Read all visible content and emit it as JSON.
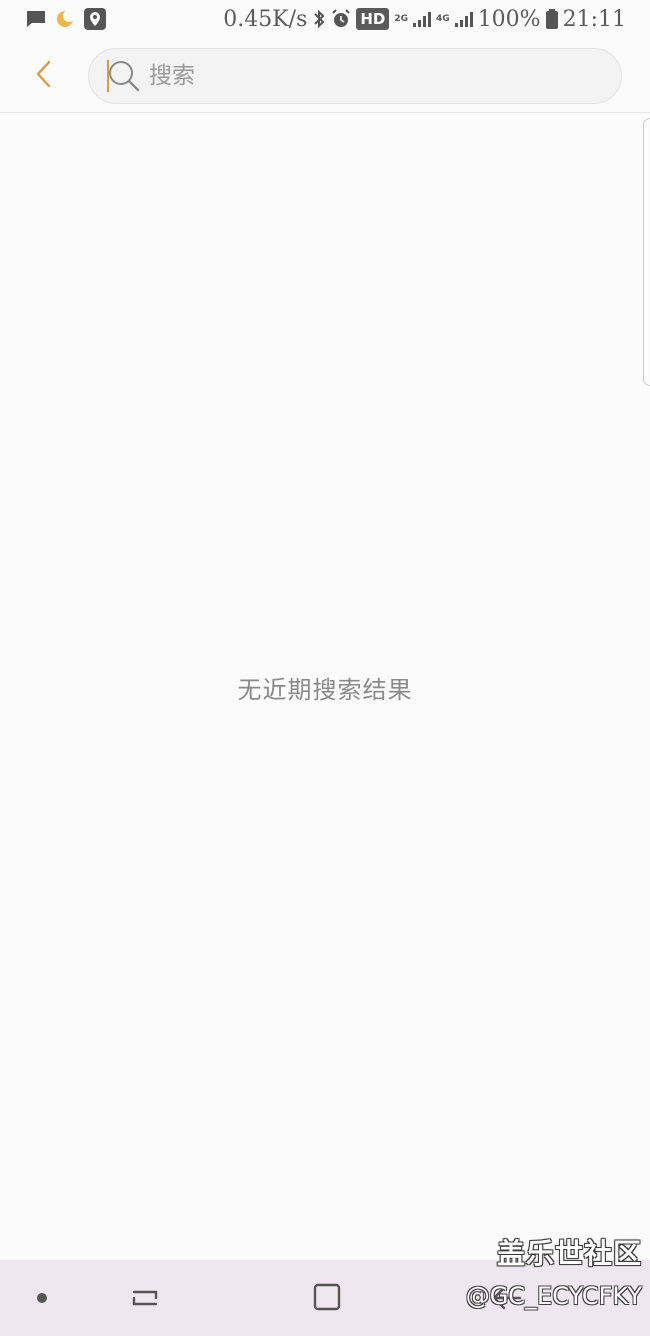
{
  "status_bar": {
    "network_speed": "0.45K/s",
    "hd_badge": "HD",
    "sim1_label": "2G",
    "sim2_label": "4G",
    "battery": "100%",
    "time": "21:11",
    "icons": [
      "message-icon",
      "moon-icon",
      "location-icon",
      "bluetooth-icon",
      "alarm-icon",
      "signal-icon",
      "battery-icon"
    ]
  },
  "search": {
    "placeholder": "搜索",
    "value": ""
  },
  "main": {
    "empty_message": "无近期搜索结果"
  },
  "watermark": {
    "title": "盖乐世社区",
    "handle": "@GC_ECYCFKY"
  },
  "colors": {
    "accent": "#d99b4a",
    "background": "#fbfbfb",
    "nav_bar": "#efe7ef"
  }
}
